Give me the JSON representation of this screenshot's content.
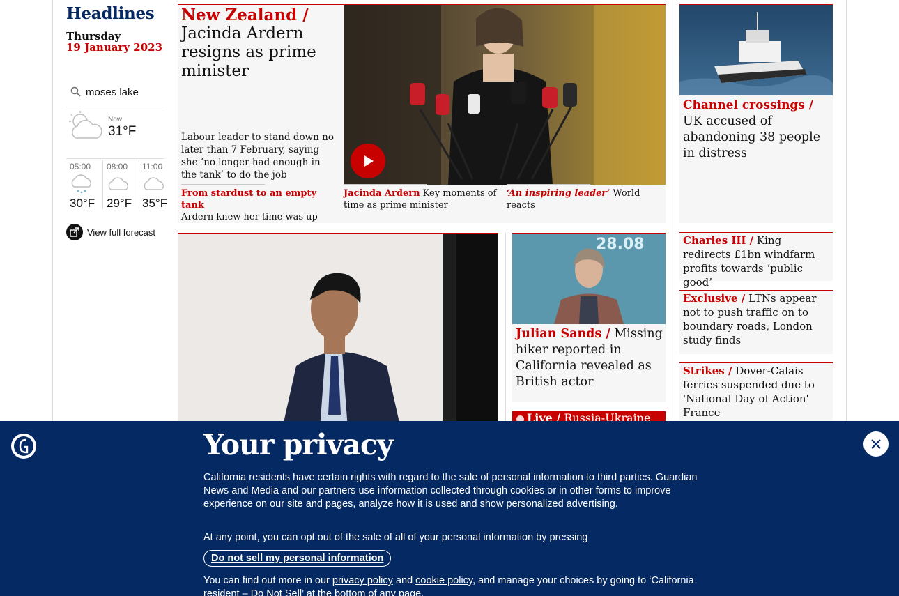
{
  "rail": {
    "section_title": "Headlines",
    "day": "Thursday",
    "date": "19 January 2023"
  },
  "weather": {
    "location": "moses lake",
    "now_label": "Now",
    "now_temp": "31°F",
    "forecast": [
      {
        "time": "05:00",
        "temp": "30°F",
        "icon": "snow-cloud-icon"
      },
      {
        "time": "08:00",
        "temp": "29°F",
        "icon": "cloud-icon"
      },
      {
        "time": "11:00",
        "temp": "35°F",
        "icon": "cloud-icon"
      }
    ],
    "full_forecast_label": "View full forecast"
  },
  "lead": {
    "kicker": "New Zealand /",
    "headline": "Jacinda Ardern resigns as prime minister",
    "standfirst": "Labour leader to stand down no later than 7 February, saying she ‘no longer had enough in the tank’ to do the job",
    "sublinks": [
      {
        "kicker": "From stardust to an empty tank",
        "text": "Ardern knew her time was up"
      },
      {
        "kicker": "Jacinda Ardern",
        "text": "Key moments of time as prime minister"
      },
      {
        "kicker": "‘An inspiring leader’",
        "text": "World reacts"
      }
    ]
  },
  "channel": {
    "kicker": "Channel crossings /",
    "headline": "UK accused of abandoning 38 people in distress"
  },
  "right_stories": [
    {
      "kicker": "Charles III /",
      "text": "King redirects £1bn windfarm profits towards ‘public good’"
    },
    {
      "kicker": "Exclusive /",
      "text": "LTNs appear not to push traffic on to boundary roads, London study finds"
    },
    {
      "kicker": "Strikes /",
      "text": "Dover-Calais ferries suspended due to 'National Day of Action' France"
    }
  ],
  "sands": {
    "kicker": "Julian Sands /",
    "text": "Missing hiker reported in California revealed as British actor"
  },
  "live": {
    "kicker": "Live /",
    "text": "Russia-Ukraine"
  },
  "privacy": {
    "title": "Your privacy",
    "p1": "California residents have certain rights with regard to the sale of personal information to third parties. Guardian News and Media and our partners use information collected through cookies or in other forms to improve experience on our site and pages, analyze how it is used and show personalized advertising.",
    "p2": "At any point, you can opt out of the sale of all of your personal information by pressing",
    "button": "Do not sell my personal information",
    "p3_a": "You can find out more in our",
    "privacy_link": "privacy policy",
    "p3_and": "and",
    "cookie_link": "cookie policy",
    "p3_b": ", and manage your choices by going to ‘California resident – Do Not Sell’ at the bottom of any page."
  },
  "colors": {
    "news_red": "#c70000",
    "guardian_blue": "#052962",
    "card_bg": "#f6f6f6"
  }
}
